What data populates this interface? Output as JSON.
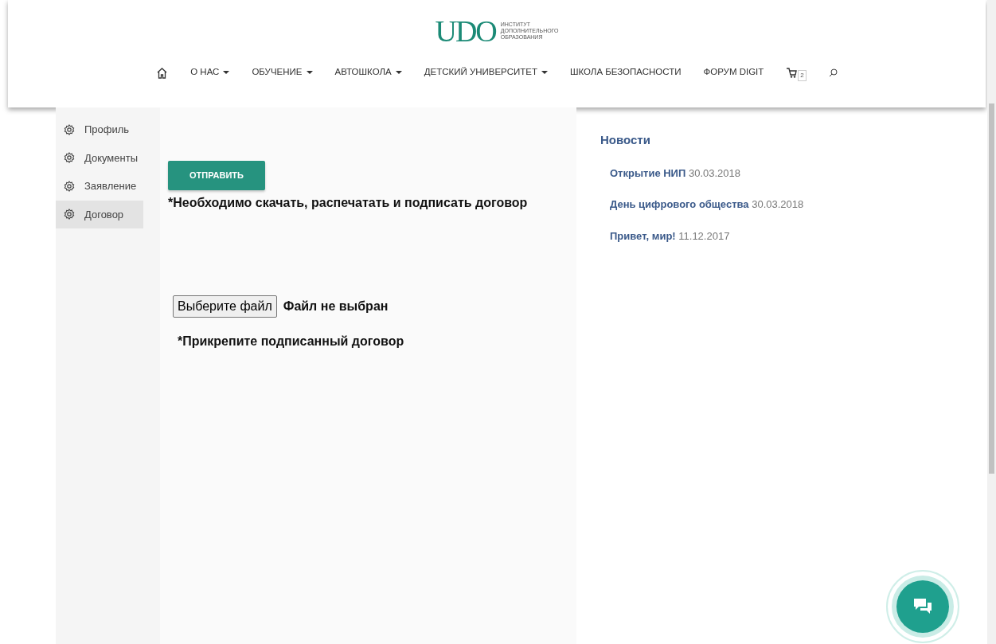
{
  "logo": {
    "mark": "UDO",
    "lines": [
      "ИНСТИТУТ",
      "ДОПОЛНИТЕЛЬНОГО",
      "ОБРАЗОВАНИЯ"
    ]
  },
  "nav": [
    {
      "label": "О НАС",
      "dropdown": true
    },
    {
      "label": "ОБУЧЕНИЕ",
      "dropdown": true
    },
    {
      "label": "АВТОШКОЛА",
      "dropdown": true
    },
    {
      "label": "ДЕТСКИЙ УНИВЕРСИТЕТ",
      "dropdown": true
    },
    {
      "label": "ШКОЛА БЕЗОПАСНОСТИ",
      "dropdown": false
    },
    {
      "label": "ФОРУМ DIGIT",
      "dropdown": false
    }
  ],
  "cart": {
    "count": "2"
  },
  "sidebar": {
    "items": [
      {
        "label": "Профиль",
        "selected": false
      },
      {
        "label": "Документы",
        "selected": false
      },
      {
        "label": "Заявление",
        "selected": false
      },
      {
        "label": "Договор",
        "selected": true
      }
    ]
  },
  "form": {
    "submit": "ОТПРАВИТЬ",
    "note_download": "*Необходимо скачать, распечатать и подписать договор",
    "file_button": "Выберите файл",
    "file_status": "Файл не выбран",
    "note_attach": "*Прикрепите подписанный договор"
  },
  "news": {
    "title": "Новости",
    "items": [
      {
        "title": "Открытие НИП",
        "date": "30.03.2018"
      },
      {
        "title": "День цифрового общества",
        "date": "30.03.2018"
      },
      {
        "title": "Привет, мир!",
        "date": "11.12.2017"
      }
    ]
  }
}
